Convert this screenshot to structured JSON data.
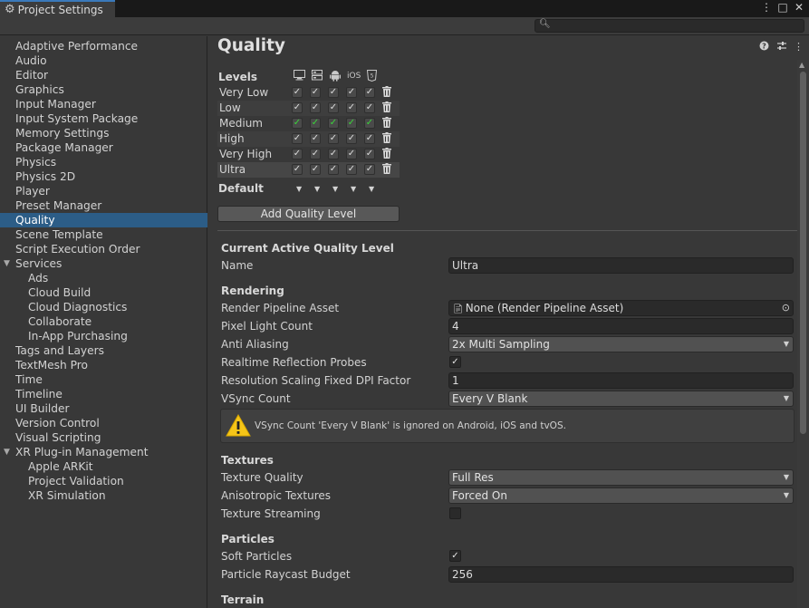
{
  "window": {
    "tab_title": "Project Settings",
    "controls": [
      "⋮",
      "□",
      "✕"
    ]
  },
  "search": {
    "placeholder": ""
  },
  "sidebar": {
    "items": [
      {
        "label": "Adaptive Performance",
        "indent": 0
      },
      {
        "label": "Audio",
        "indent": 0
      },
      {
        "label": "Editor",
        "indent": 0
      },
      {
        "label": "Graphics",
        "indent": 0
      },
      {
        "label": "Input Manager",
        "indent": 0
      },
      {
        "label": "Input System Package",
        "indent": 0
      },
      {
        "label": "Memory Settings",
        "indent": 0
      },
      {
        "label": "Package Manager",
        "indent": 0
      },
      {
        "label": "Physics",
        "indent": 0
      },
      {
        "label": "Physics 2D",
        "indent": 0
      },
      {
        "label": "Player",
        "indent": 0
      },
      {
        "label": "Preset Manager",
        "indent": 0
      },
      {
        "label": "Quality",
        "indent": 0,
        "selected": true
      },
      {
        "label": "Scene Template",
        "indent": 0
      },
      {
        "label": "Script Execution Order",
        "indent": 0
      },
      {
        "label": "Services",
        "indent": 0,
        "expandable": true
      },
      {
        "label": "Ads",
        "indent": 1
      },
      {
        "label": "Cloud Build",
        "indent": 1
      },
      {
        "label": "Cloud Diagnostics",
        "indent": 1
      },
      {
        "label": "Collaborate",
        "indent": 1
      },
      {
        "label": "In-App Purchasing",
        "indent": 1
      },
      {
        "label": "Tags and Layers",
        "indent": 0
      },
      {
        "label": "TextMesh Pro",
        "indent": 0
      },
      {
        "label": "Time",
        "indent": 0
      },
      {
        "label": "Timeline",
        "indent": 0
      },
      {
        "label": "UI Builder",
        "indent": 0
      },
      {
        "label": "Version Control",
        "indent": 0
      },
      {
        "label": "Visual Scripting",
        "indent": 0
      },
      {
        "label": "XR Plug-in Management",
        "indent": 0,
        "expandable": true
      },
      {
        "label": "Apple ARKit",
        "indent": 1
      },
      {
        "label": "Project Validation",
        "indent": 1
      },
      {
        "label": "XR Simulation",
        "indent": 1
      }
    ]
  },
  "main": {
    "title": "Quality",
    "header_icons": [
      "help-icon",
      "presets-icon",
      "more-menu-icon"
    ],
    "levels": {
      "label": "Levels",
      "platforms": [
        "standalone-icon",
        "server-icon",
        "android-icon",
        "iOS",
        "webgl-icon"
      ],
      "rows": [
        {
          "name": "Very Low",
          "highlight_default": false
        },
        {
          "name": "Low",
          "highlight_default": false
        },
        {
          "name": "Medium",
          "highlight_default": true
        },
        {
          "name": "High",
          "highlight_default": false
        },
        {
          "name": "Very High",
          "highlight_default": false
        },
        {
          "name": "Ultra",
          "highlight_default": false,
          "active": true
        }
      ],
      "default_label": "Default",
      "add_button": "Add Quality Level"
    },
    "current": {
      "heading": "Current Active Quality Level",
      "name_label": "Name",
      "name_value": "Ultra"
    },
    "rendering": {
      "heading": "Rendering",
      "pipeline_label": "Render Pipeline Asset",
      "pipeline_value": "None (Render Pipeline Asset)",
      "pixel_light_label": "Pixel Light Count",
      "pixel_light_value": "4",
      "aa_label": "Anti Aliasing",
      "aa_value": "2x Multi Sampling",
      "reflection_label": "Realtime Reflection Probes",
      "reflection_checked": true,
      "dpi_label": "Resolution Scaling Fixed DPI Factor",
      "dpi_value": "1",
      "vsync_label": "VSync Count",
      "vsync_value": "Every V Blank",
      "warning": "VSync Count 'Every V Blank' is ignored on Android, iOS and tvOS."
    },
    "textures": {
      "heading": "Textures",
      "quality_label": "Texture Quality",
      "quality_value": "Full Res",
      "aniso_label": "Anisotropic Textures",
      "aniso_value": "Forced On",
      "streaming_label": "Texture Streaming",
      "streaming_checked": false
    },
    "particles": {
      "heading": "Particles",
      "soft_label": "Soft Particles",
      "soft_checked": true,
      "raycast_label": "Particle Raycast Budget",
      "raycast_value": "256"
    },
    "terrain": {
      "heading": "Terrain"
    }
  },
  "colors": {
    "background": "#383838",
    "selection": "#2c5d87",
    "field": "#2a2a2a",
    "default_check": "#3ad63a",
    "warning": "#f5c518"
  }
}
